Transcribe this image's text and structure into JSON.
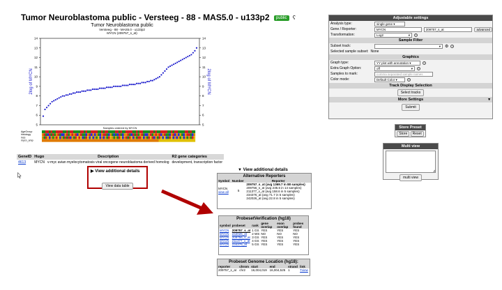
{
  "page": {
    "title": "Tumor Neuroblastoma public - Versteeg - 88 - MAS5.0 - u133p2",
    "badge": "public",
    "ctrl_icon": "ʕ"
  },
  "chart": {
    "title": "Tumor Neuroblastoma public",
    "subtitle1": "Versteeg - 88 - MAS5.0 - u133p2",
    "subtitle2": "MYCN (209757_s_at)",
    "ylabel_left": "2log of MYCN",
    "ylabel_right": "2log of MYCN",
    "xlabel": "Samples ordered by MYCN",
    "y_ticks": [
      "14",
      "13",
      "12",
      "11",
      "10",
      "9",
      "8",
      "7",
      "6",
      "5"
    ],
    "track_labels": [
      "AgeGroup",
      "histology",
      "inss",
      "mycn_amp"
    ],
    "point_color": "#1a1acc"
  },
  "chart_data": {
    "type": "scatter",
    "title": "Tumor Neuroblastoma public",
    "xlabel": "Samples ordered by MYCN",
    "ylabel": "2log of MYCN",
    "ylim": [
      5,
      14
    ],
    "series": [
      {
        "values": [
          5.9,
          6.6,
          6.8,
          7.0,
          7.2,
          7.4,
          7.5,
          7.6,
          7.7,
          7.8,
          7.9,
          8.0,
          8.0,
          8.1,
          8.1,
          8.2,
          8.2,
          8.3,
          8.3,
          8.4,
          8.4,
          8.4,
          8.5,
          8.5,
          8.5,
          8.6,
          8.6,
          8.6,
          8.7,
          8.7,
          8.7,
          8.7,
          8.8,
          8.8,
          8.8,
          8.8,
          8.9,
          8.9,
          8.9,
          8.9,
          9.0,
          9.0,
          9.0,
          9.0,
          9.0,
          9.1,
          9.1,
          9.1,
          9.1,
          9.2,
          9.2,
          9.2,
          9.2,
          9.3,
          9.3,
          9.3,
          9.4,
          9.4,
          9.4,
          9.5,
          9.5,
          9.6,
          9.6,
          9.7,
          9.8,
          9.9,
          10.0,
          10.2,
          10.4,
          10.6,
          10.8,
          11.0,
          11.1,
          11.2,
          11.3,
          11.4,
          11.5,
          11.6,
          11.7,
          11.8,
          11.9,
          12.0,
          12.1,
          12.2,
          12.3,
          12.5,
          12.7,
          13.0
        ]
      }
    ]
  },
  "gene_table": {
    "headers": [
      "GeneID",
      "Hugo",
      "Description",
      "R2 gene categories"
    ],
    "row": [
      "4613",
      "MYCN",
      "v-myc avian myelocytomatosis viral oncogene neuroblastoma derived homolog",
      "development, transcription factor"
    ]
  },
  "view_additional_1": {
    "label": "▶ View additional details",
    "button": "View data table"
  },
  "view_additional_2": {
    "label": "▼ View additional details"
  },
  "alt_reporters": {
    "title": "Alternative Reporters",
    "headers": [
      "Symbol",
      "Number",
      "Reporter"
    ],
    "symbol": "MYCN",
    "symbol_link": "view all",
    "number": "5",
    "reporters": [
      "209757_s_at (avg 1369.7 in 88 samples)",
      "209756_s_at (avg 235.6 in 14 samples)",
      "211377_x_at (avg 158.6 in 5 samples)",
      "234376_at (avg 71.7 in 5 samples)",
      "242026_at (avg 22.8 in 5 samples)"
    ]
  },
  "probeset_verification": {
    "title": "ProbesetVerification (hg18)",
    "headers": [
      "symbol",
      "probeset",
      "rank",
      "gene overlap",
      "exon overlap",
      "probes found"
    ],
    "rows": [
      [
        "MYCN",
        "209757_s_at",
        "1 GS",
        "YES",
        "YES",
        "YES"
      ],
      [
        "MYCN",
        "242026_at",
        "2 WS",
        "NO",
        "NO",
        "NO"
      ],
      [
        "MYCN",
        "209756_s_at",
        "3 GS",
        "YES",
        "YES",
        "YES"
      ],
      [
        "MYCN",
        "211377_x_at",
        "4 GS",
        "YES",
        "YES",
        "YES"
      ],
      [
        "MYCN",
        "234376_at",
        "5 GS",
        "YES",
        "YES",
        "YES"
      ]
    ]
  },
  "genome_location": {
    "title": "Probeset Genome Location (hg18):",
    "headers": [
      "reporter",
      "chrom",
      "start",
      "end",
      "strand",
      "link"
    ],
    "row": [
      "209757_s_at",
      "chr2",
      "16,004,019",
      "16,004,525",
      "1",
      "Tview"
    ]
  },
  "settings": {
    "title": "Adjustable settings",
    "analysis_label": "Analysis type:",
    "analysis_value": "single gene",
    "gene_label": "Gene / Reporter:",
    "gene_value": "MYCN",
    "reporter_value": "209757_s_at",
    "advanced": "advanced",
    "transform_label": "Transformation:",
    "transform_value": "Log2",
    "sample_filter": "Sample Filter",
    "subset_label": "Subset track:",
    "selected_label": "Selected sample subset:",
    "selected_value": "None",
    "graphics": "Graphics",
    "graph_type_label": "Graph type:",
    "graph_type_value": "YY plot with annotation",
    "extra_label": "Extra Graph Option:",
    "extra_value": "off",
    "samples_mark_label": "Samples to mark:",
    "samples_mark_placeholder": "comma separated sample names",
    "color_mode_label": "Color mode:",
    "color_mode_value": "Default Color",
    "track_display": "Track Display Selection",
    "select_tracks": "Select tracks",
    "more_settings": "More Settings",
    "submit": "Submit"
  },
  "store_preset": {
    "title": "Store Preset",
    "store": "Store",
    "reset": "Reset"
  },
  "multi_view": {
    "title": "Multi view",
    "button": "multi view"
  }
}
